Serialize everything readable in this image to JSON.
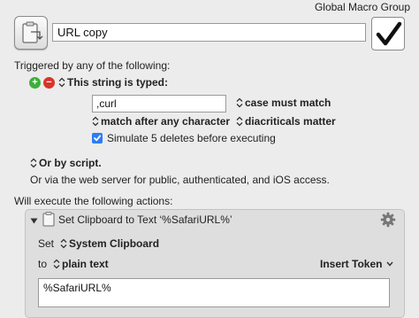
{
  "header": {
    "group_name": "Global Macro Group",
    "macro_name": "URL copy"
  },
  "triggers": {
    "intro": "Triggered by any of the following:",
    "typed_string_label": "This string is typed:",
    "typed_string_value": ",curl",
    "case_option": "case must match",
    "match_option": "match after any character",
    "diacriticals_option": "diacriticals matter",
    "simulate_deletes_label": "Simulate 5 deletes before executing",
    "simulate_deletes_checked": true,
    "or_by_script": "Or by script.",
    "web_server_note": "Or via the web server for public, authenticated, and iOS access."
  },
  "actions": {
    "intro": "Will execute the following actions:",
    "items": [
      {
        "title": "Set Clipboard to Text ‘%SafariURL%’",
        "set_label": "Set",
        "clipboard_select": "System Clipboard",
        "to_label": "to",
        "format_select": "plain text",
        "insert_token_label": "Insert Token",
        "text_value": "%SafariURL%"
      }
    ]
  },
  "colors": {
    "accent_blue": "#2e7cf6",
    "add_green": "#3fae3a",
    "remove_red": "#d9342b"
  }
}
